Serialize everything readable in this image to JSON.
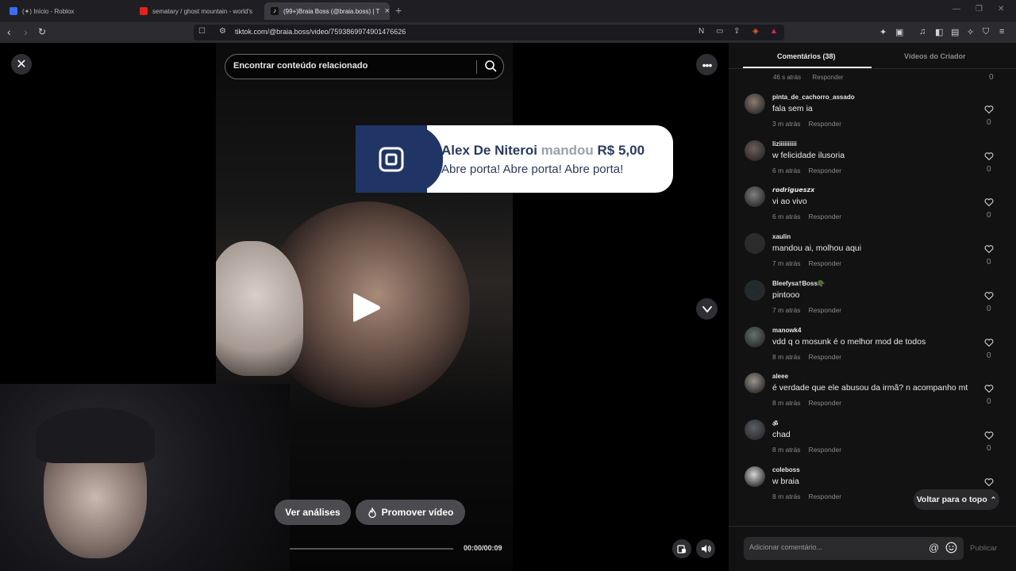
{
  "browser": {
    "tabs": [
      {
        "title": "(✦) Início - Roblox"
      },
      {
        "title": "sematary / ghost mountain - world's"
      },
      {
        "title": "(99+)Braia Boss (@braia.boss) | T"
      }
    ],
    "url": "tiktok.com/@braia.boss/video/7593869974901476626"
  },
  "video": {
    "search_placeholder": "Encontrar conteúdo relacionado",
    "btn_analises": "Ver análises",
    "btn_promover": "Promover vídeo",
    "time": "00:00/00:09"
  },
  "donation": {
    "donor": "Alex De Niteroi",
    "verb": "mandou",
    "amount": "R$ 5,00",
    "message": "Abre porta! Abre porta! Abre porta!"
  },
  "panel": {
    "tab_comments": "Comentários (38)",
    "tab_creator": "Vídeos do Criador",
    "top_partial": {
      "time": "46 s atrás",
      "reply": "Responder",
      "likes": "0"
    },
    "comments": [
      {
        "user": "pinta_de_cachorro_assado",
        "text": "fala sem ia",
        "time": "3 m atrás",
        "reply": "Responder",
        "likes": "0"
      },
      {
        "user": "liziiiiiiiiii",
        "text": "w felicidade ilusoria",
        "time": "6 m atrás",
        "reply": "Responder",
        "likes": "0"
      },
      {
        "user": "𝙧𝙤𝙙𝙧𝙞𝙜𝙪𝙚𝙨𝙯𝙭",
        "text": "vi ao vivo",
        "time": "6 m atrás",
        "reply": "Responder",
        "likes": "0"
      },
      {
        "user": "xaulin",
        "text": "mandou ai, molhou aqui",
        "time": "7 m atrás",
        "reply": "Responder",
        "likes": "0"
      },
      {
        "user": "Bleefysa†Boss🪖",
        "text": "pintooo",
        "time": "7 m atrás",
        "reply": "Responder",
        "likes": "0"
      },
      {
        "user": "manowk4",
        "text": "vdd q o mosunk é o melhor mod de todos",
        "time": "8 m atrás",
        "reply": "Responder",
        "likes": "0"
      },
      {
        "user": "aleee",
        "text": "é verdade que ele abusou da irmã? n acompanho mt",
        "time": "8 m atrás",
        "reply": "Responder",
        "likes": "0"
      },
      {
        "user": "ॐ",
        "text": "chad",
        "time": "8 m atrás",
        "reply": "Responder",
        "likes": "0"
      },
      {
        "user": "coleboss",
        "text": "w braia",
        "time": "8 m atrás",
        "reply": "Responder",
        "likes": ""
      }
    ],
    "back_to_top": "Voltar para o topo",
    "compose_placeholder": "Adicionar comentário...",
    "publish": "Publicar"
  },
  "colors": {
    "donation_blue": "#203565",
    "panel_bg": "#121212",
    "tiktok_pink": "#fe2c55"
  }
}
